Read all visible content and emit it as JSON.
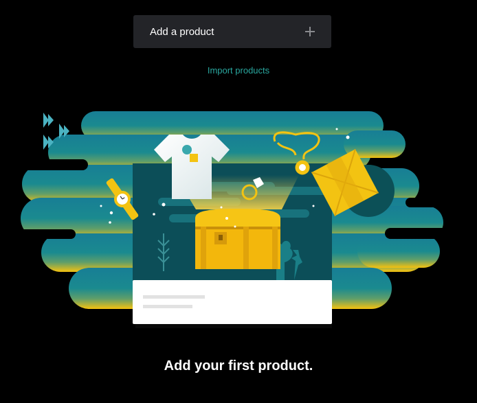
{
  "toolbar": {
    "add_product_label": "Add a product",
    "add_icon": "plus-icon"
  },
  "import": {
    "label": "Import products"
  },
  "empty_state": {
    "headline": "Add your first product.",
    "illustration": "treasure-chest-products-illustration"
  },
  "colors": {
    "background": "#000000",
    "button_bg": "#232428",
    "link": "#2aa8a0",
    "teal": "#1b8d9c",
    "deep_teal": "#0e5560",
    "gold": "#f3c312"
  }
}
